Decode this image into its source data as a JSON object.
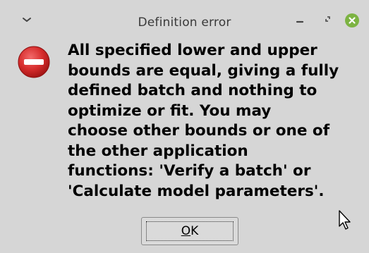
{
  "dialog": {
    "title": "Definition error",
    "message": "All specified lower and upper\nbounds are equal, giving a fully\ndefined batch and nothing to\noptimize or fit. You may\nchoose other bounds or one of\nthe other application\nfunctions: 'Verify a batch' or\n'Calculate model parameters'.",
    "ok_mnemonic": "O",
    "ok_rest": "K"
  },
  "icons": {
    "menu": "chevron-down-icon",
    "minimize": "minimize-icon",
    "maximize": "maximize-icon",
    "close": "close-icon",
    "error": "error-icon",
    "cursor": "mouse-pointer-icon"
  },
  "colors": {
    "background": "#d6d6d6",
    "close_button": "#7cb342",
    "error_icon": "#d62c2c"
  }
}
